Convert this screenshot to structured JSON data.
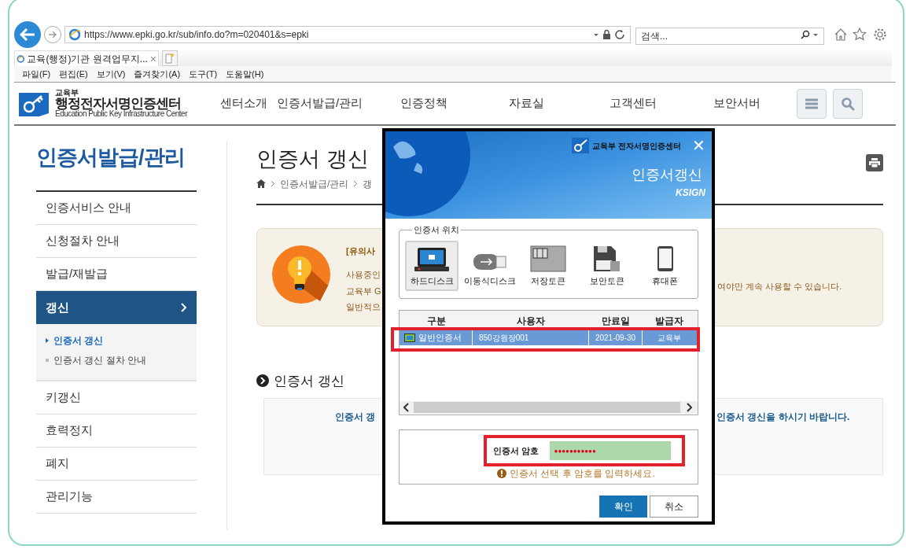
{
  "browser": {
    "url": "https://www.epki.go.kr/sub/info.do?m=020401&s=epki",
    "search": {
      "placeholder": "검색..."
    },
    "tab": {
      "title": "교육(행정)기관 원격업무지...",
      "close": "×"
    },
    "menu": [
      "파일(F)",
      "편집(E)",
      "보기(V)",
      "즐겨찾기(A)",
      "도구(T)",
      "도움말(H)"
    ]
  },
  "site": {
    "logo_small": "교육부",
    "logo_title": "행정전자서명인증센터",
    "logo_subtitle": "Education Public Key Infrastructure Center",
    "nav": [
      "센터소개",
      "인증서발급/관리",
      "인증정책",
      "자료실",
      "고객센터",
      "보안서버"
    ]
  },
  "sidebar": {
    "title": "인증서발급/관리",
    "items": [
      {
        "label": "인증서비스 안내",
        "selected": false
      },
      {
        "label": "신청절차 안내",
        "selected": false
      },
      {
        "label": "발급/재발급",
        "selected": false
      },
      {
        "label": "갱신",
        "selected": true,
        "children": [
          {
            "label": "인증서 갱신",
            "selected": true
          },
          {
            "label": "인증서 갱신 절차 안내",
            "selected": false
          }
        ]
      },
      {
        "label": "키갱신",
        "selected": false
      },
      {
        "label": "효력정지",
        "selected": false
      },
      {
        "label": "폐지",
        "selected": false
      },
      {
        "label": "관리기능",
        "selected": false
      }
    ]
  },
  "content": {
    "title": "인증서 갱신",
    "breadcrumb": [
      "인증서발급/관리",
      "갱"
    ],
    "notice": {
      "heading": "[유의사",
      "lines": [
        "사용중인",
        "교육부 G",
        "일반적으"
      ],
      "right_text": "여야만 계속 사용할 수 있습니다."
    },
    "section": {
      "heading": "인증서 갱신",
      "left_text": "인증서 갱",
      "right_text": "인증서 갱신을 하시기 바랍니다."
    }
  },
  "dialog": {
    "brand": "교육부 전자서명인증센터",
    "title": "인증서갱신",
    "maker": "KSIGN",
    "close": "✕",
    "location": {
      "legend": "인증서 위치",
      "media": [
        {
          "kind": "harddisk",
          "label": "하드디스크",
          "selected": true
        },
        {
          "kind": "usb",
          "label": "이동식디스크",
          "selected": false
        },
        {
          "kind": "storage_token",
          "label": "저장토큰",
          "selected": false
        },
        {
          "kind": "security_token",
          "label": "보안토큰",
          "selected": false
        },
        {
          "kind": "phone",
          "label": "휴대폰",
          "selected": false
        }
      ]
    },
    "table": {
      "columns": [
        "구분",
        "사용자",
        "만료일",
        "발급자"
      ],
      "rows": [
        {
          "cells": [
            "일반인증서",
            "850강원장001",
            "2021-09-30",
            "교육부"
          ],
          "selected": true,
          "highlighted": true
        }
      ]
    },
    "password": {
      "label": "인증서 암호",
      "value": "●●●●●●●●●●●",
      "highlighted": true,
      "hint": "인증서 선택 후 암호를 입력하세요."
    },
    "buttons": [
      {
        "label": "확인",
        "kind": "primary"
      },
      {
        "label": "취소",
        "kind": "secondary"
      }
    ]
  }
}
